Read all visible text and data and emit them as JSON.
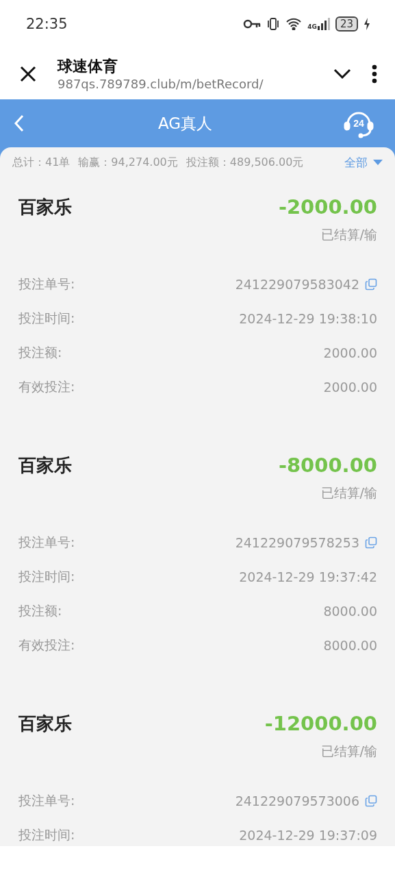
{
  "status_bar": {
    "time": "22:35",
    "network_type": "4G",
    "battery": "23"
  },
  "browser_bar": {
    "title": "球速体育",
    "url": "987qs.789789.club/m/betRecord/"
  },
  "header": {
    "title": "AG真人",
    "support_badge": "24"
  },
  "summary": {
    "total": "总计：41单",
    "win_loss": "输赢：94,274.00元",
    "bet_amount": "投注额：489,506.00元",
    "filter": "全部"
  },
  "records": [
    {
      "game": "百家乐",
      "amount": "-2000.00",
      "status": "已结算/输",
      "fields": [
        {
          "kind": "copy",
          "label": "投注单号:",
          "value": "241229079583042"
        },
        {
          "kind": "plain",
          "label": "投注时间:",
          "value": "2024-12-29 19:38:10"
        },
        {
          "kind": "plain",
          "label": "投注额:",
          "value": "2000.00"
        },
        {
          "kind": "plain",
          "label": "有效投注:",
          "value": "2000.00"
        }
      ]
    },
    {
      "game": "百家乐",
      "amount": "-8000.00",
      "status": "已结算/输",
      "fields": [
        {
          "kind": "copy",
          "label": "投注单号:",
          "value": "241229079578253"
        },
        {
          "kind": "plain",
          "label": "投注时间:",
          "value": "2024-12-29 19:37:42"
        },
        {
          "kind": "plain",
          "label": "投注额:",
          "value": "8000.00"
        },
        {
          "kind": "plain",
          "label": "有效投注:",
          "value": "8000.00"
        }
      ]
    },
    {
      "game": "百家乐",
      "amount": "-12000.00",
      "status": "已结算/输",
      "fields": [
        {
          "kind": "copy",
          "label": "投注单号:",
          "value": "241229079573006"
        },
        {
          "kind": "plain",
          "label": "投注时间:",
          "value": "2024-12-29 19:37:09"
        }
      ]
    }
  ]
}
